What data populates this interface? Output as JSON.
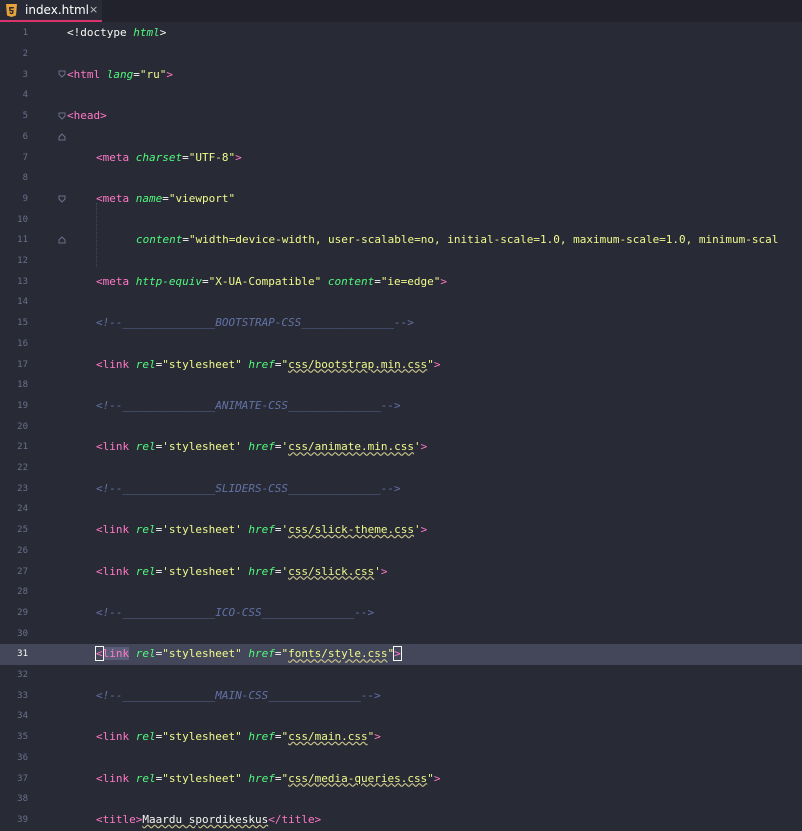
{
  "tab": {
    "label": "index.html",
    "close": "×",
    "icon": "html5-file-icon"
  },
  "colors": {
    "accent": "#d8336b",
    "background": "#282a36",
    "active_line": "#44475a",
    "tag": "#ff79c6",
    "attr": "#50fa7b",
    "string": "#f1fa8c",
    "comment": "#6272a4"
  },
  "editor": {
    "active_line": 31,
    "lines": [
      {
        "n": "1"
      },
      {
        "n": "2"
      },
      {
        "n": "3"
      },
      {
        "n": "4"
      },
      {
        "n": "5"
      },
      {
        "n": "6"
      },
      {
        "n": "7"
      },
      {
        "n": "8"
      },
      {
        "n": "9"
      },
      {
        "n": "10"
      },
      {
        "n": "11"
      },
      {
        "n": "12"
      },
      {
        "n": "13"
      },
      {
        "n": "14"
      },
      {
        "n": "15"
      },
      {
        "n": "16"
      },
      {
        "n": "17"
      },
      {
        "n": "18"
      },
      {
        "n": "19"
      },
      {
        "n": "20"
      },
      {
        "n": "21"
      },
      {
        "n": "22"
      },
      {
        "n": "23"
      },
      {
        "n": "24"
      },
      {
        "n": "25"
      },
      {
        "n": "26"
      },
      {
        "n": "27"
      },
      {
        "n": "28"
      },
      {
        "n": "29"
      },
      {
        "n": "30"
      },
      {
        "n": "31"
      },
      {
        "n": "32"
      },
      {
        "n": "33"
      },
      {
        "n": "34"
      },
      {
        "n": "35"
      },
      {
        "n": "36"
      },
      {
        "n": "37"
      },
      {
        "n": "38"
      },
      {
        "n": "39"
      }
    ],
    "code": {
      "l1": [
        "<!doctype ",
        "html",
        ">"
      ],
      "l3": [
        "<html ",
        "lang",
        "=",
        "\"ru\"",
        ">"
      ],
      "l5": [
        "<head>"
      ],
      "l7": [
        "<meta ",
        "charset",
        "=",
        "\"UTF-8\"",
        ">"
      ],
      "l9": [
        "<meta ",
        "name",
        "=",
        "\"viewport\""
      ],
      "l11": [
        "content",
        "=",
        "\"width=device-width, user-scalable=no, initial-scale=1.0, maximum-scale=1.0, minimum-scal"
      ],
      "l13": [
        "<meta ",
        "http-equiv",
        "=",
        "\"X-UA-Compatible\"",
        " ",
        "content",
        "=",
        "\"ie=edge\"",
        ">"
      ],
      "l15": [
        "<!--______________BOOTSTRAP-CSS______________-->"
      ],
      "l17": [
        "<link ",
        "rel",
        "=",
        "\"stylesheet\"",
        " ",
        "href",
        "=",
        "\"",
        "css/bootstrap.min.css",
        "\"",
        ">"
      ],
      "l19": [
        "<!--______________ANIMATE-CSS______________-->"
      ],
      "l21": [
        "<link ",
        "rel",
        "=",
        "'stylesheet'",
        " ",
        "href",
        "=",
        "'",
        "css/animate.min.css",
        "'",
        ">"
      ],
      "l23": [
        "<!--______________SLIDERS-CSS______________-->"
      ],
      "l25": [
        "<link ",
        "rel",
        "=",
        "'stylesheet'",
        " ",
        "href",
        "=",
        "'",
        "css/slick-theme.css",
        "'",
        ">"
      ],
      "l27": [
        "<link ",
        "rel",
        "=",
        "'stylesheet'",
        " ",
        "href",
        "=",
        "'",
        "css/slick.css",
        "'",
        ">"
      ],
      "l29": [
        "<!--______________ICO-CSS______________-->"
      ],
      "l31": [
        "<",
        "link",
        " ",
        "rel",
        "=",
        "\"stylesheet\"",
        " ",
        "href",
        "=",
        "\"",
        "fonts/style.css",
        "\"",
        ">"
      ],
      "l33": [
        "<!--______________MAIN-CSS______________-->"
      ],
      "l35": [
        "<link ",
        "rel",
        "=",
        "\"stylesheet\"",
        " ",
        "href",
        "=",
        "\"",
        "css/main.css",
        "\"",
        ">"
      ],
      "l37": [
        "<link ",
        "rel",
        "=",
        "\"stylesheet\"",
        " ",
        "href",
        "=",
        "\"",
        "css/media-queries.css",
        "\"",
        ">"
      ],
      "l39": [
        "<title>",
        "Maardu spordikeskus",
        "</title>"
      ]
    }
  }
}
